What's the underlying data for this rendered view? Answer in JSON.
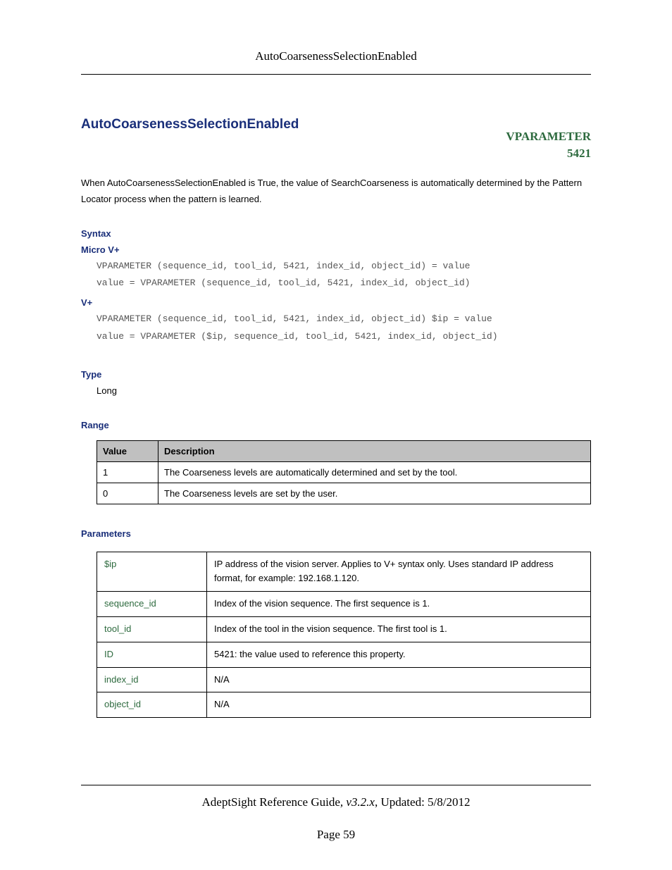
{
  "header": {
    "running_title": "AutoCoarsenessSelectionEnabled"
  },
  "title": "AutoCoarsenessSelectionEnabled",
  "vparam": {
    "label": "VPARAMETER",
    "code": "5421"
  },
  "intro": "When AutoCoarsenessSelectionEnabled is True, the value of SearchCoarseness is automatically determined by the Pattern Locator process when the pattern is learned.",
  "sections": {
    "syntax_label": "Syntax",
    "microv_label": "Micro V+",
    "microv_code": "VPARAMETER (sequence_id, tool_id, 5421, index_id, object_id) = value\nvalue = VPARAMETER (sequence_id, tool_id, 5421, index_id, object_id)",
    "vplus_label": "V+",
    "vplus_code": "VPARAMETER (sequence_id, tool_id, 5421, index_id, object_id) $ip = value\nvalue = VPARAMETER ($ip, sequence_id, tool_id, 5421, index_id, object_id)",
    "type_label": "Type",
    "type_value": "Long",
    "range_label": "Range",
    "parameters_label": "Parameters"
  },
  "range_table": {
    "headers": [
      "Value",
      "Description"
    ],
    "rows": [
      [
        "1",
        "The Coarseness levels are automatically determined and set by the tool."
      ],
      [
        "0",
        "The Coarseness levels are set by the user."
      ]
    ]
  },
  "param_table": {
    "rows": [
      [
        "$ip",
        "IP address of the vision server. Applies to V+ syntax only. Uses standard IP address format, for example: 192.168.1.120."
      ],
      [
        "sequence_id",
        "Index of the vision sequence. The first sequence is 1."
      ],
      [
        "tool_id",
        "Index of the tool in the vision sequence. The first tool is 1."
      ],
      [
        "ID",
        "5421: the value used to reference this property."
      ],
      [
        "index_id",
        "N/A"
      ],
      [
        "object_id",
        "N/A"
      ]
    ]
  },
  "footer": {
    "guide": "AdeptSight Reference Guide",
    "version": ", v3.2.x",
    "updated": ", Updated: 5/8/2012",
    "page": "Page 59"
  }
}
